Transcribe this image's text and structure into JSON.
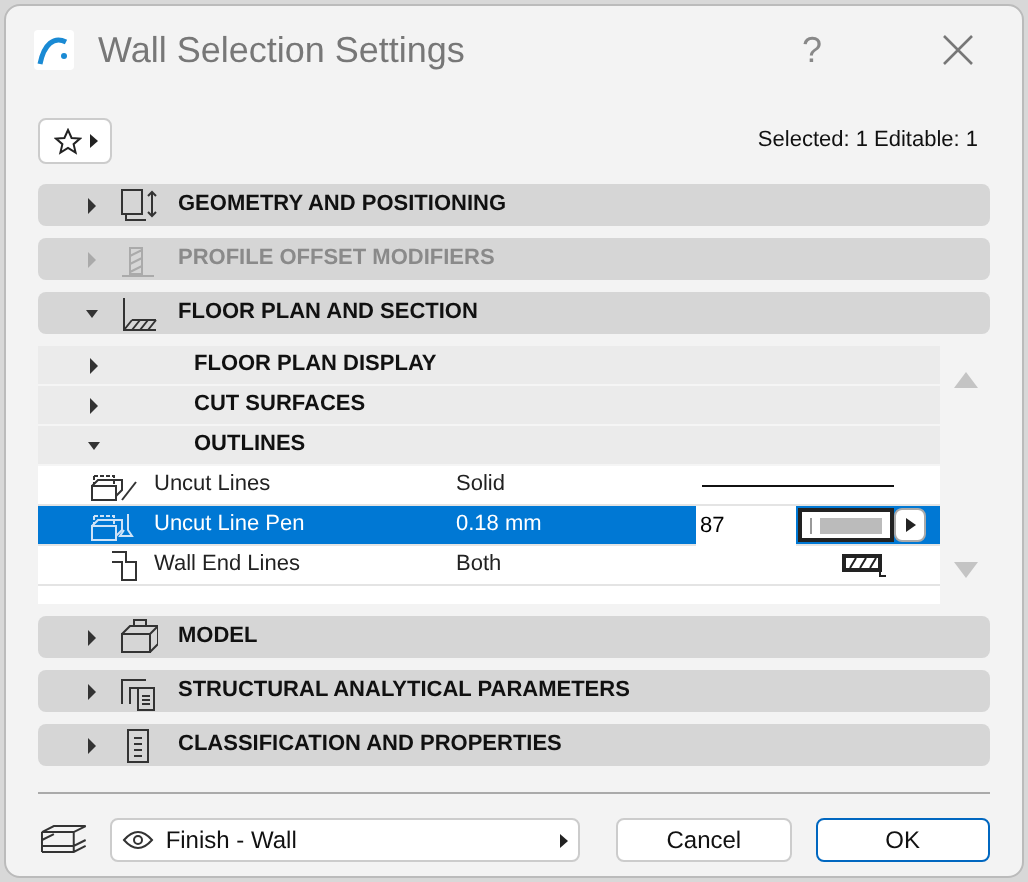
{
  "window": {
    "title": "Wall Selection Settings",
    "help": "?"
  },
  "status": "Selected: 1 Editable: 1",
  "sections": [
    {
      "title": "GEOMETRY AND POSITIONING",
      "expanded": false,
      "disabled": false
    },
    {
      "title": "PROFILE OFFSET MODIFIERS",
      "expanded": false,
      "disabled": true
    },
    {
      "title": "FLOOR PLAN AND SECTION",
      "expanded": true,
      "disabled": false,
      "subsections": [
        {
          "title": "FLOOR PLAN DISPLAY",
          "expanded": false
        },
        {
          "title": "CUT SURFACES",
          "expanded": false
        },
        {
          "title": "OUTLINES",
          "expanded": true,
          "rows": [
            {
              "kind": "line",
              "label": "Uncut Lines",
              "value": "Solid",
              "selected": false
            },
            {
              "kind": "pen",
              "label": "Uncut Line Pen",
              "value": "0.18 mm",
              "selected": true,
              "pen_number": "87"
            },
            {
              "kind": "end",
              "label": "Wall End Lines",
              "value": "Both",
              "selected": false
            }
          ]
        }
      ]
    },
    {
      "title": "MODEL",
      "expanded": false,
      "disabled": false
    },
    {
      "title": "STRUCTURAL ANALYTICAL PARAMETERS",
      "expanded": false,
      "disabled": false
    },
    {
      "title": "CLASSIFICATION AND PROPERTIES",
      "expanded": false,
      "disabled": false
    }
  ],
  "layer": "Finish - Wall",
  "buttons": [
    {
      "label": "Cancel",
      "default": false
    },
    {
      "label": "OK",
      "default": true
    }
  ]
}
